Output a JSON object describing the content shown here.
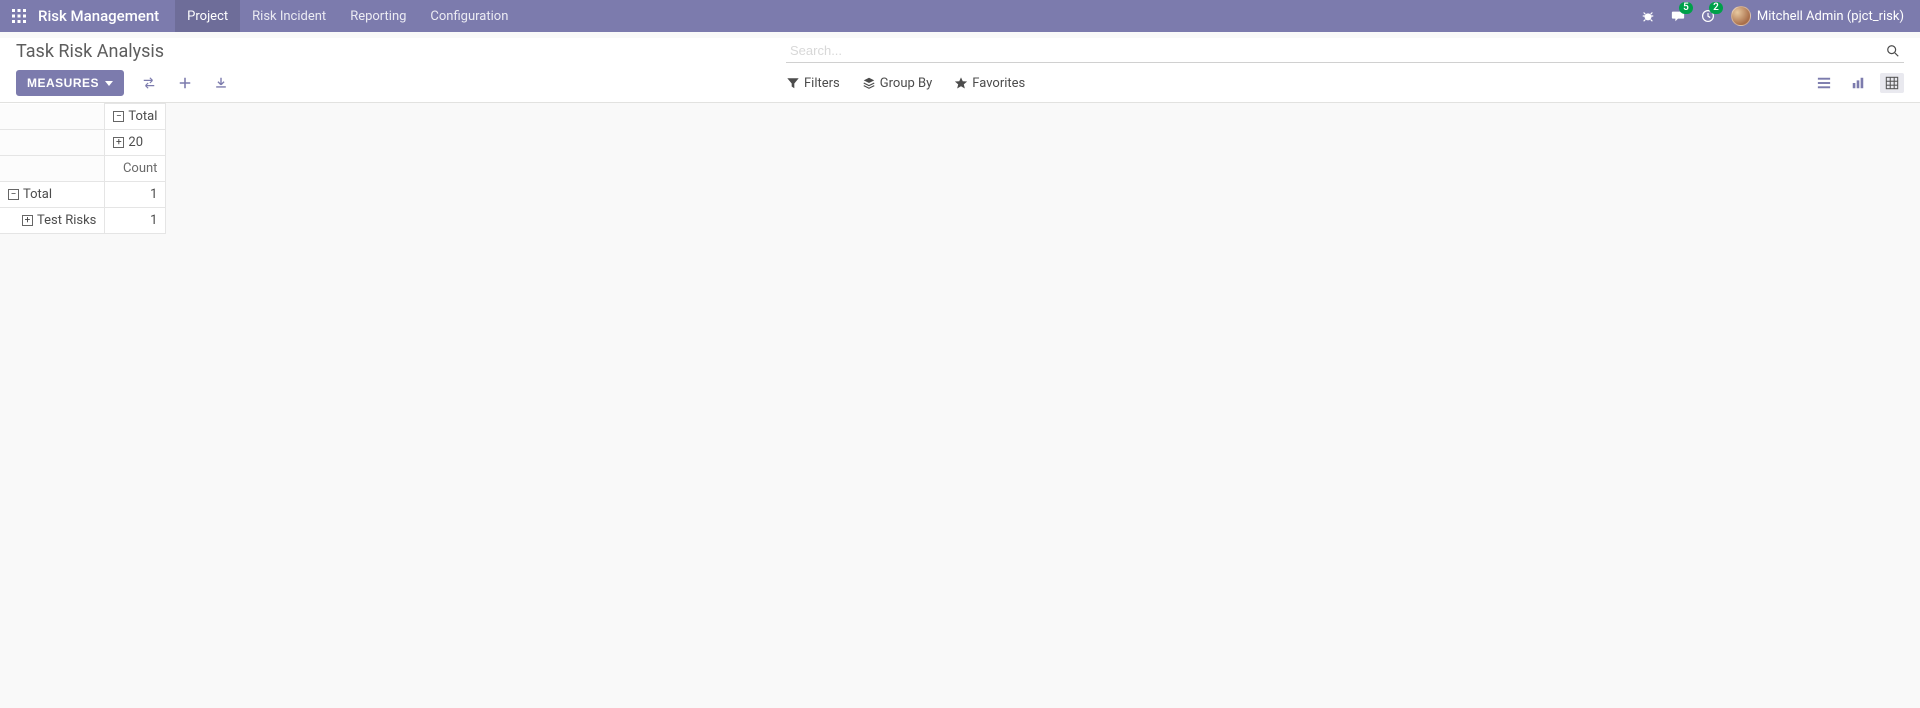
{
  "navbar": {
    "brand": "Risk Management",
    "menu": [
      {
        "label": "Project",
        "active": true
      },
      {
        "label": "Risk Incident",
        "active": false
      },
      {
        "label": "Reporting",
        "active": false
      },
      {
        "label": "Configuration",
        "active": false
      }
    ],
    "user_label": "Mitchell Admin (pjct_risk)",
    "badges": {
      "messages": "5",
      "activities": "2"
    }
  },
  "breadcrumb": "Task Risk Analysis",
  "search": {
    "placeholder": "Search..."
  },
  "measures_btn": "MEASURES",
  "search_options": {
    "filters": "Filters",
    "groupby": "Group By",
    "favorites": "Favorites"
  },
  "pivot": {
    "col_total": "Total",
    "col_group": "20",
    "count_label": "Count",
    "rows": [
      {
        "label": "Total",
        "indent": 0,
        "expanded": true,
        "value": "1"
      },
      {
        "label": "Test Risks",
        "indent": 1,
        "expanded": false,
        "value": "1"
      }
    ]
  }
}
